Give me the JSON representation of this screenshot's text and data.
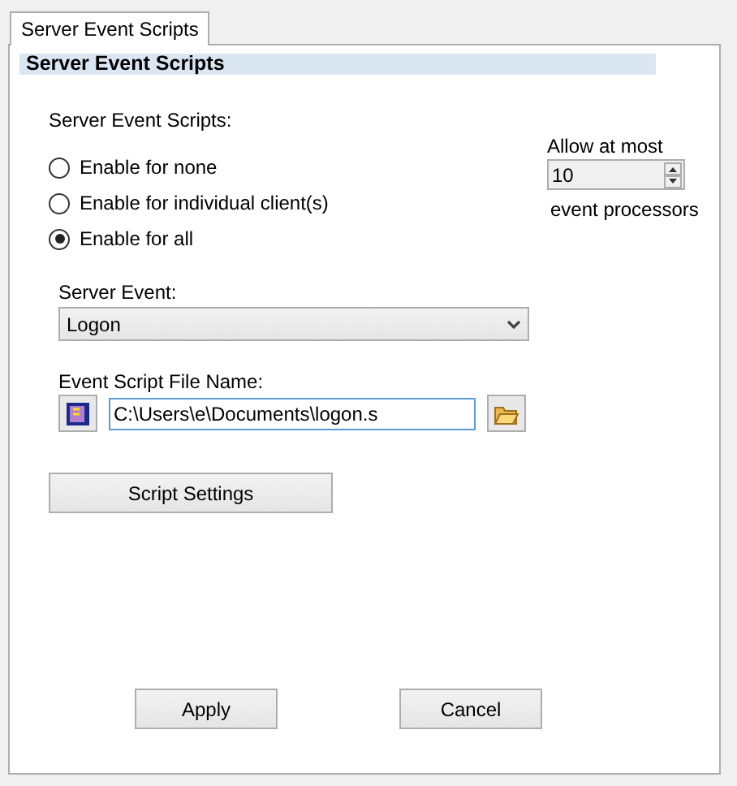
{
  "tabs": [
    {
      "label": "Server Event Scripts",
      "selected": true
    }
  ],
  "section_header": "Server Event Scripts",
  "scripts_group": {
    "label": "Server Event Scripts:",
    "options": [
      {
        "label": "Enable for none",
        "selected": false
      },
      {
        "label": "Enable for individual client(s)",
        "selected": false
      },
      {
        "label": "Enable for all",
        "selected": true
      }
    ]
  },
  "processors": {
    "label_before": "Allow at most",
    "value": "10",
    "label_after": "event processors"
  },
  "server_event": {
    "label": "Server Event:",
    "value": "Logon"
  },
  "script_file": {
    "label": "Event Script File Name:",
    "value": "C:\\Users\\e\\Documents\\logon.s"
  },
  "script_settings_button": "Script Settings",
  "buttons": [
    "Apply",
    "Cancel"
  ]
}
